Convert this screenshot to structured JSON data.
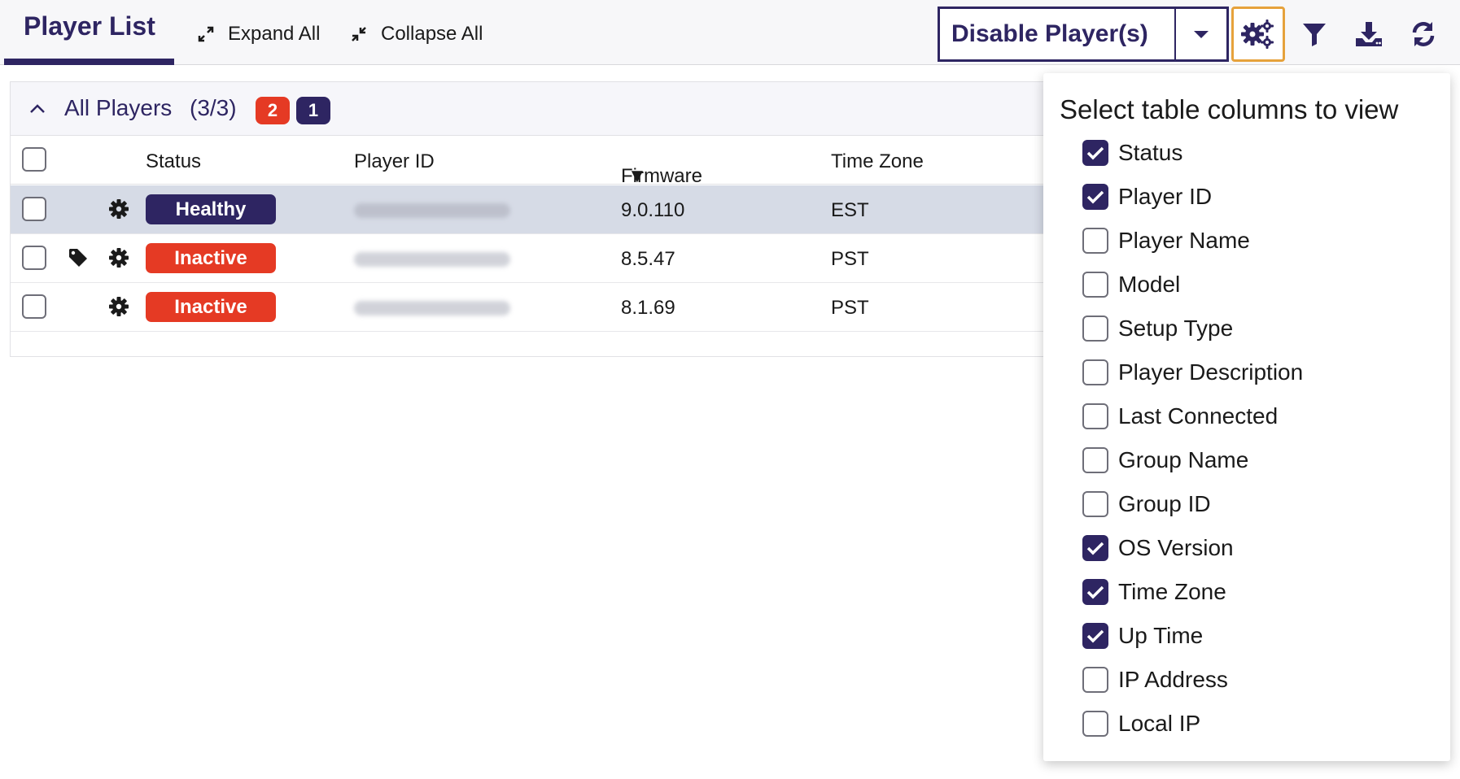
{
  "toolbar": {
    "title": "Player List",
    "expand_all": "Expand All",
    "collapse_all": "Collapse All",
    "disable_button": "Disable Player(s)",
    "icons": {
      "expand": "expand-icon",
      "collapse": "collapse-icon",
      "dropdown": "caret-down-icon",
      "columns": "column-settings-icon",
      "filter": "filter-icon",
      "download": "download-icon",
      "refresh": "refresh-icon"
    }
  },
  "group": {
    "title": "All Players",
    "count": "(3/3)",
    "badge_red": "2",
    "badge_navy": "1"
  },
  "table": {
    "headers": {
      "status": "Status",
      "player_id": "Player ID",
      "firmware": "Firmware",
      "time_zone": "Time Zone"
    },
    "sort_indicator": "▼",
    "rows": [
      {
        "status": "Healthy",
        "firmware": "9.0.110",
        "time_zone": "EST",
        "tagged": false,
        "selected_highlight": true
      },
      {
        "status": "Inactive",
        "firmware": "8.5.47",
        "time_zone": "PST",
        "tagged": true,
        "selected_highlight": false
      },
      {
        "status": "Inactive",
        "firmware": "8.1.69",
        "time_zone": "PST",
        "tagged": false,
        "selected_highlight": false
      }
    ]
  },
  "columns_panel": {
    "title": "Select table columns to view",
    "options": [
      {
        "label": "Status",
        "checked": true
      },
      {
        "label": "Player ID",
        "checked": true
      },
      {
        "label": "Player Name",
        "checked": false
      },
      {
        "label": "Model",
        "checked": false
      },
      {
        "label": "Setup Type",
        "checked": false
      },
      {
        "label": "Player Description",
        "checked": false
      },
      {
        "label": "Last Connected",
        "checked": false
      },
      {
        "label": "Group Name",
        "checked": false
      },
      {
        "label": "Group ID",
        "checked": false
      },
      {
        "label": "OS Version",
        "checked": true
      },
      {
        "label": "Time Zone",
        "checked": true
      },
      {
        "label": "Up Time",
        "checked": true
      },
      {
        "label": "IP Address",
        "checked": false
      },
      {
        "label": "Local IP",
        "checked": false
      }
    ]
  },
  "colors": {
    "brand": "#2e2562",
    "danger": "#e53a24",
    "focus_outline": "#e6a23c",
    "row_highlight": "#d6dbe6"
  }
}
